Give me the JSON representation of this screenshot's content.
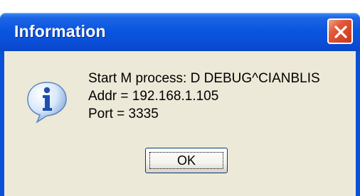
{
  "window": {
    "title": "Information",
    "close_icon": "close-icon"
  },
  "icon": {
    "name": "information-icon"
  },
  "message": {
    "line1": "Start M process:  D DEBUG^CIANBLIS",
    "line2": "Addr = 192.168.1.105",
    "line3": "Port = 3335"
  },
  "buttons": {
    "ok_label": "OK"
  },
  "colors": {
    "titlebar": "#0a4fd8",
    "dialog_bg": "#ece9d8",
    "close_btn": "#e2593a"
  }
}
